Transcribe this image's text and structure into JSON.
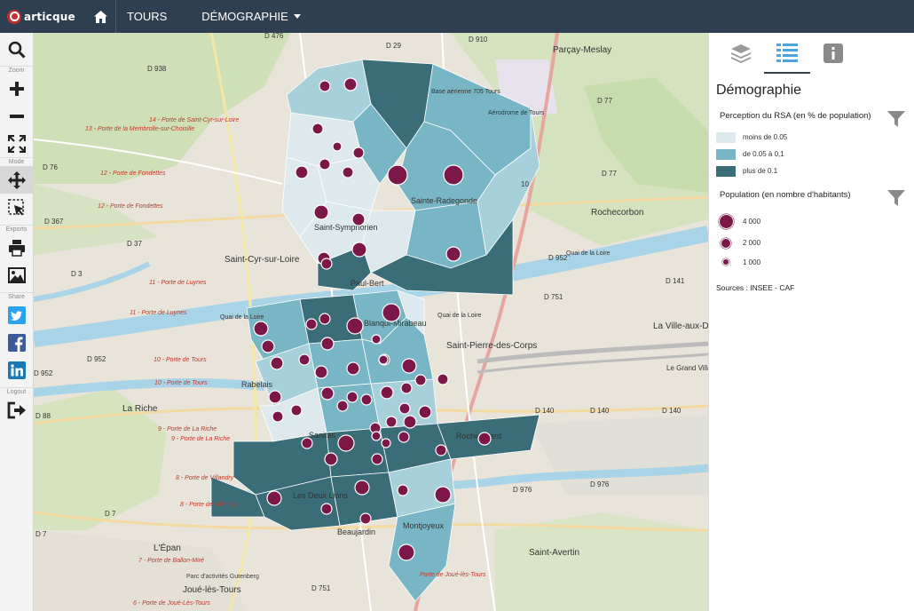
{
  "app": {
    "logo_text": "articque"
  },
  "nav": {
    "tours": "TOURS",
    "demographie": "DÉMOGRAPHIE"
  },
  "toolbar": {
    "zoom": "Zoom",
    "mode": "Mode",
    "exports": "Exports",
    "share": "Share",
    "logout": "Logout"
  },
  "panel": {
    "title": "Démographie",
    "rsa_title": "Perception du RSA (en % de population)",
    "rsa_classes": [
      {
        "label": "moins de 0.05",
        "color": "#dde9ec"
      },
      {
        "label": "de 0.05 à 0,1",
        "color": "#79b6c5"
      },
      {
        "label": "plus de 0.1",
        "color": "#3b6d78"
      }
    ],
    "pop_title": "Population (en nombre d'habitants)",
    "pop_classes": [
      {
        "label": "4 000"
      },
      {
        "label": "2 000"
      },
      {
        "label": "1 000"
      }
    ],
    "sources": "Sources : INSEE - CAF"
  },
  "map": {
    "labels": [
      "Saint-Cyr-sur-Loire",
      "La Riche",
      "Saint-Pierre-des-Corps",
      "Saint-Avertin",
      "Joué-lès-Tours",
      "Rochecorbon",
      "Parçay-Meslay",
      "La Ville-aux-Dames",
      "L'Épan",
      "Le Grand Village",
      "Base aérienne 705 Tours",
      "Aérodrome de Tours",
      "Sainte-Radegonde",
      "Saint-Symphorien",
      "Paul-Bert",
      "Sanitas",
      "Rabelais",
      "Montjoyeux",
      "Les Deux Lions",
      "Rochepinard",
      "Beaujardin",
      "Blanqui-Mirabeau",
      "Quai de la Loire",
      "Quai de la Loire",
      "Quai de la Loire",
      "D 476",
      "D 29",
      "D 910",
      "D 938",
      "D 76",
      "D 367",
      "D 37",
      "D 3",
      "D 952",
      "D 952",
      "D 77",
      "D 77",
      "D 141",
      "D 751",
      "D 751",
      "D 140",
      "D 140",
      "D 140",
      "D 976",
      "D 976",
      "D 7",
      "D 7",
      "D 88",
      "D 952",
      "10",
      "14 - Porte de Saint-Cyr-sur-Loire",
      "13 - Porte de la Membrolle-sur-Choisille",
      "12 - Porte de Fondettes",
      "12 - Porte de Fondettes",
      "11 - Porte de Luynes",
      "11 - Porte de Luynes",
      "10 - Porte de Tours",
      "10 - Porte de Tours",
      "9 - Porte de La Riche",
      "9 - Porte de La Riche",
      "8 - Porte de Villandry",
      "8 - Porte de Villandry",
      "7 - Porte de Ballon-Miré",
      "6 - Porte de Joué-Lès-Tours",
      "Parc d'activités Gutenberg",
      "Porte de Joué-lès-Tours"
    ]
  }
}
